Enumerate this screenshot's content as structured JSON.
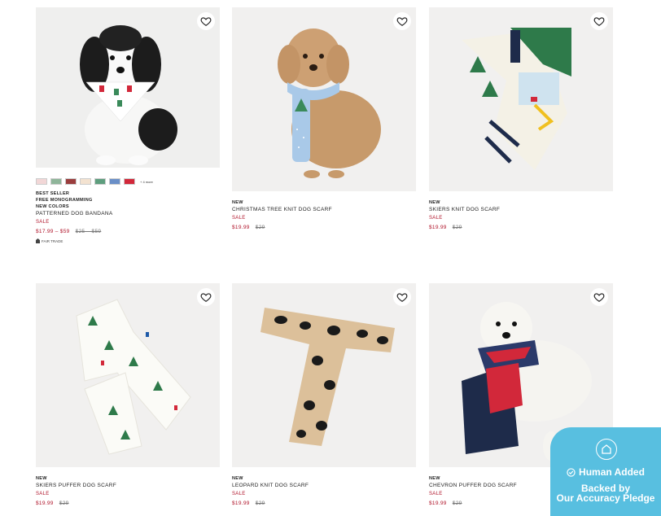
{
  "products": [
    {
      "tags": [
        "BEST SELLER",
        "FREE MONOGRAMMING",
        "NEW COLORS"
      ],
      "name": "PATTERNED DOG BANDANA",
      "sale": "SALE",
      "price": "$17.99 – $59",
      "was": "$25 – $59",
      "swatches": [
        "#f2d7d7",
        "#8fb59a",
        "#9a3d3d",
        "#f3e2d0",
        "#5e9e7e",
        "#6a8fc7",
        "#d2283a"
      ],
      "more": "+ 4 more",
      "fair": "FAIR TRADE",
      "image": "dog-bandana-photo"
    },
    {
      "tags": [
        "NEW"
      ],
      "name": "CHRISTMAS TREE KNIT DOG SCARF",
      "sale": "SALE",
      "price": "$19.99",
      "was": "$29",
      "image": "christmas-tree-scarf-photo"
    },
    {
      "tags": [
        "NEW"
      ],
      "name": "SKIERS KNIT DOG SCARF",
      "sale": "SALE",
      "price": "$19.99",
      "was": "$29",
      "image": "skiers-knit-scarf-photo"
    },
    {
      "tags": [
        "NEW"
      ],
      "name": "SKIERS PUFFER DOG SCARF",
      "sale": "SALE",
      "price": "$19.99",
      "was": "$29",
      "image": "skiers-puffer-scarf-photo"
    },
    {
      "tags": [
        "NEW"
      ],
      "name": "LEOPARD KNIT DOG SCARF",
      "sale": "SALE",
      "price": "$19.99",
      "was": "$29",
      "image": "leopard-knit-scarf-photo"
    },
    {
      "tags": [
        "NEW"
      ],
      "name": "CHEVRON PUFFER DOG SCARF",
      "sale": "SALE",
      "price": "$19.99",
      "was": "$29",
      "image": "chevron-puffer-scarf-photo"
    }
  ],
  "badge": {
    "line1": "Human Added",
    "line2": "Backed by",
    "line3": "Our Accuracy Pledge",
    "color": "#58bfe0"
  },
  "colors": {
    "sale": "#b0142a"
  }
}
